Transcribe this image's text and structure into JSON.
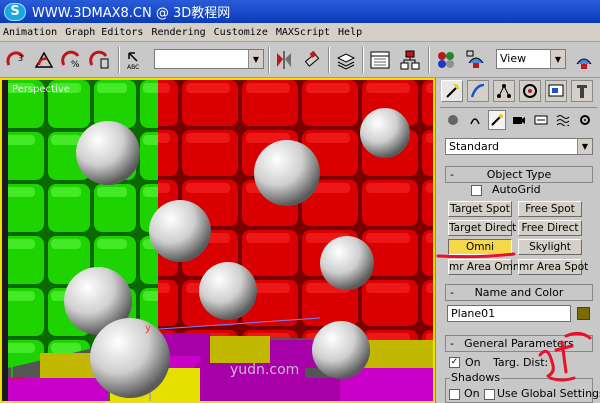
{
  "title_bar": {
    "app_icon_letter": "S",
    "title": "WWW.3DMAX8.CN @ 3D教程网"
  },
  "menu": {
    "items": [
      "Animation",
      "Graph Editors",
      "Rendering",
      "Customize",
      "MAXScript",
      "Help"
    ]
  },
  "toolbar": {
    "selection_set_value": "",
    "view_combo_value": "View",
    "icons": [
      "snap-3d-icon",
      "angle-snap-icon",
      "percent-snap-icon",
      "spinner-snap-icon",
      "named-selection-icon",
      "mirror-icon",
      "align-icon",
      "layer-manager-icon",
      "curve-editor-icon",
      "schematic-view-icon",
      "material-editor-icon",
      "render-scene-icon",
      "quick-render-icon"
    ]
  },
  "viewport": {
    "label": "Perspective",
    "watermark": "yudn.com",
    "axis_label": "y"
  },
  "panel": {
    "tabs": [
      "create-tab",
      "modify-tab",
      "hierarchy-tab",
      "motion-tab",
      "display-tab",
      "utilities-tab"
    ],
    "subcategories": [
      "geometry-icon",
      "shapes-icon",
      "lights-icon",
      "cameras-icon",
      "helpers-icon",
      "space-warps-icon",
      "systems-icon"
    ],
    "category_dropdown": "Standard",
    "object_type": {
      "title": "Object Type",
      "sign": "-",
      "autogrid_label": "AutoGrid",
      "buttons": [
        {
          "label": "Target Spot",
          "pressed": false
        },
        {
          "label": "Free Spot",
          "pressed": false
        },
        {
          "label": "Target Direct",
          "pressed": false
        },
        {
          "label": "Free Direct",
          "pressed": false
        },
        {
          "label": "Omni",
          "pressed": true
        },
        {
          "label": "Skylight",
          "pressed": false
        },
        {
          "label": "mr Area Omni",
          "pressed": false
        },
        {
          "label": "mr Area Spot",
          "pressed": false
        }
      ]
    },
    "name_and_color": {
      "title": "Name and Color",
      "sign": "-",
      "name_value": "Plane01",
      "color": "#7a6a00"
    },
    "general_parameters": {
      "title": "General Parameters",
      "sign": "-",
      "on_label": "On",
      "targ_dist_label": "Targ. Dist:",
      "shadows_label": "Shadows",
      "shadows_on_label": "On",
      "use_global_label": "Use Global Settings"
    }
  },
  "colors": {
    "accent_yellow": "#f3e000",
    "annotation_red": "#e8102a",
    "pressed_button": "#f6d84b"
  }
}
